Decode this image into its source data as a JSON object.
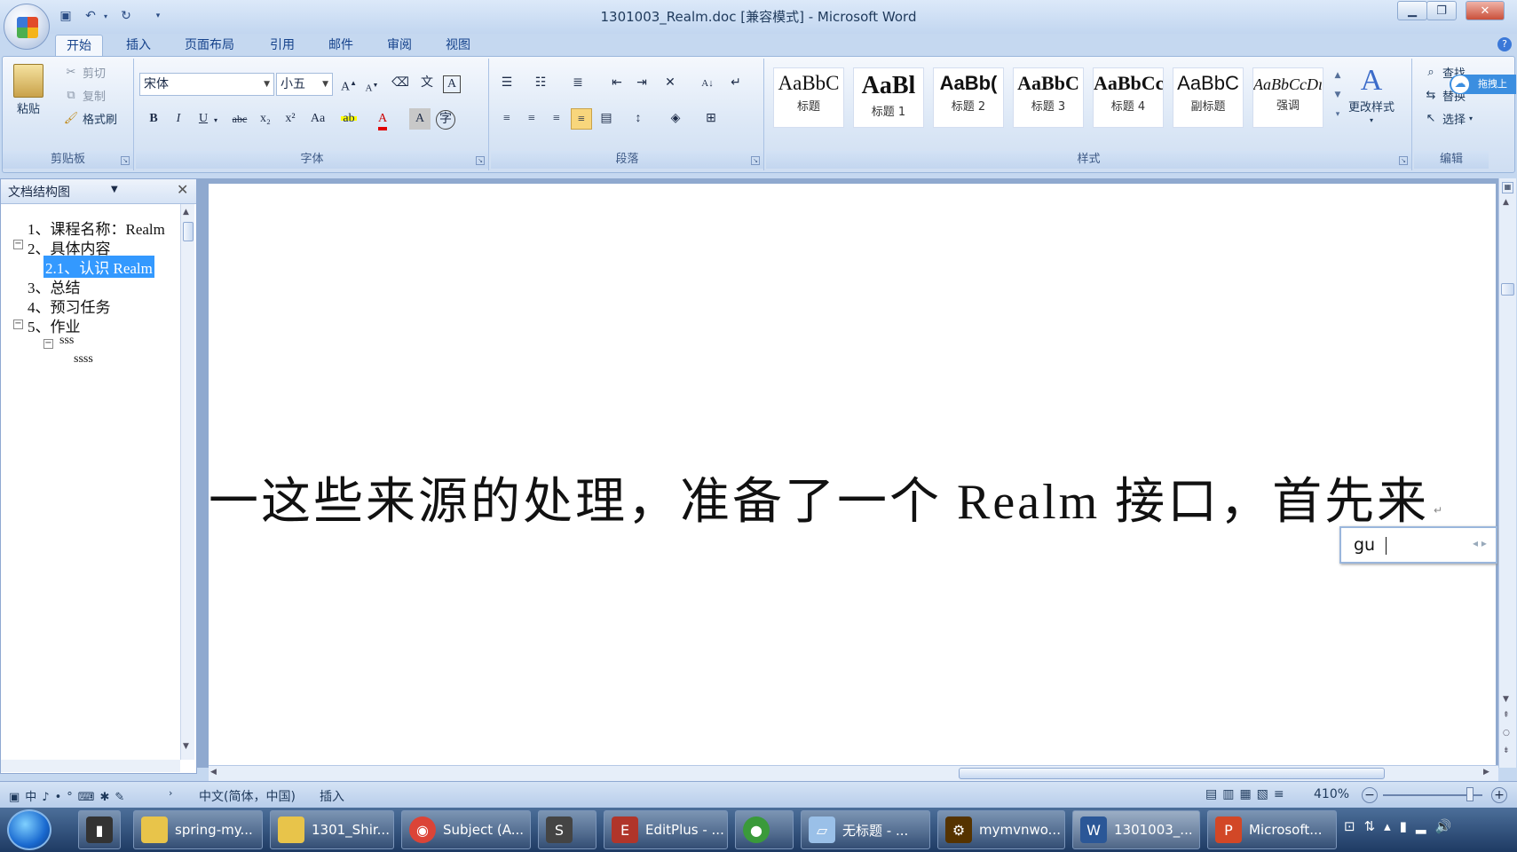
{
  "window": {
    "title": "1301003_Realm.doc [兼容模式] - Microsoft Word"
  },
  "qat": {
    "save": "save-icon",
    "undo": "undo-icon",
    "redo": "redo-icon"
  },
  "tabs": [
    {
      "label": "开始",
      "active": true
    },
    {
      "label": "插入"
    },
    {
      "label": "页面布局"
    },
    {
      "label": "引用"
    },
    {
      "label": "邮件"
    },
    {
      "label": "审阅"
    },
    {
      "label": "视图"
    }
  ],
  "ribbon": {
    "clipboard": {
      "label": "剪贴板",
      "paste": "粘贴",
      "cut": "剪切",
      "copy": "复制",
      "format_painter": "格式刷"
    },
    "font": {
      "label": "字体",
      "family": "宋体",
      "size": "小五",
      "bold": "B",
      "italic": "I",
      "underline": "U",
      "strike": "abc",
      "subscript": "x₂",
      "superscript": "x²",
      "change_case": "Aa",
      "grow": "A",
      "shrink": "A",
      "clear": "A",
      "highlight_color": "#ffff00",
      "font_color": "#e00000"
    },
    "paragraph": {
      "label": "段落"
    },
    "styles": {
      "label": "样式",
      "items": [
        {
          "preview": "AaBbC",
          "name": "标题"
        },
        {
          "preview": "AaBl",
          "name": "标题 1"
        },
        {
          "preview": "AaBb(",
          "name": "标题 2"
        },
        {
          "preview": "AaBbC",
          "name": "标题 3"
        },
        {
          "preview": "AaBbCc",
          "name": "标题 4"
        },
        {
          "preview": "AaBbC",
          "name": "副标题"
        },
        {
          "preview": "AaBbCcDı",
          "name": "强调"
        }
      ],
      "change_styles": "更改样式"
    },
    "editing": {
      "label": "编辑",
      "find": "查找",
      "replace": "替换",
      "select": "选择",
      "float_label": "拖拽上"
    }
  },
  "nav": {
    "title": "文档结构图",
    "items": [
      {
        "text": "1、课程名称：Realm",
        "level": 1
      },
      {
        "text": "2、具体内容",
        "level": 1,
        "toggle": "⊟"
      },
      {
        "text": "2.1、认识 Realm",
        "level": 2,
        "selected": true
      },
      {
        "text": "3、总结",
        "level": 1
      },
      {
        "text": "4、预习任务",
        "level": 1
      },
      {
        "text": "5、作业",
        "level": 1,
        "toggle": "⊟"
      },
      {
        "text": "sss",
        "level": 2,
        "toggle": "⊟"
      },
      {
        "text": "ssss",
        "level": 3
      }
    ]
  },
  "document": {
    "text": "一这些来源的处理，准备了一个 Realm 接口，首先来"
  },
  "ime": {
    "input": "gu"
  },
  "status": {
    "language": "中文(简体，中国)",
    "mode": "插入",
    "zoom": "410%"
  },
  "taskbar": {
    "items": [
      {
        "label": "spring-my...",
        "color": "#e8c44a"
      },
      {
        "label": "1301_Shir...",
        "color": "#e8c44a"
      },
      {
        "label": "Subject (A...",
        "color": "#db4437"
      },
      {
        "label": "",
        "color": "#444444"
      },
      {
        "label": "EditPlus - ...",
        "color": "#b0352a"
      },
      {
        "label": "",
        "color": "#3a9a3a"
      },
      {
        "label": "无标题 - ...",
        "color": "#9ac0e8"
      },
      {
        "label": "mymvnwo...",
        "color": "#553300"
      },
      {
        "label": "1301003_...",
        "color": "#2b5797"
      },
      {
        "label": "Microsoft...",
        "color": "#d24726"
      }
    ]
  }
}
